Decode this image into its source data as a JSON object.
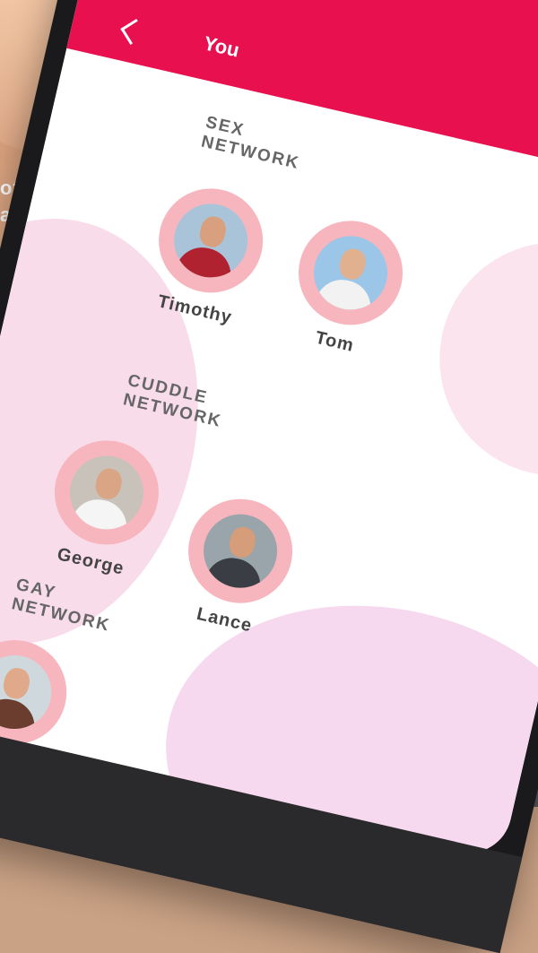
{
  "overlay_text": {
    "line1": "of",
    "line2": "alue"
  },
  "app": {
    "title": "You"
  },
  "sections": [
    {
      "line1": "SEX",
      "line2": "NETWORK"
    },
    {
      "line1": "CUDDLE",
      "line2": "NETWORK"
    },
    {
      "line1": "GAY",
      "line2": "NETWORK"
    }
  ],
  "people": [
    {
      "name": "Timothy"
    },
    {
      "name": "Tom"
    },
    {
      "name": "George"
    },
    {
      "name": "Lance"
    },
    {
      "name": ""
    }
  ],
  "colors": {
    "accent": "#e8104e",
    "ring": "#f7b6bd",
    "blob": "#f9dcea"
  }
}
